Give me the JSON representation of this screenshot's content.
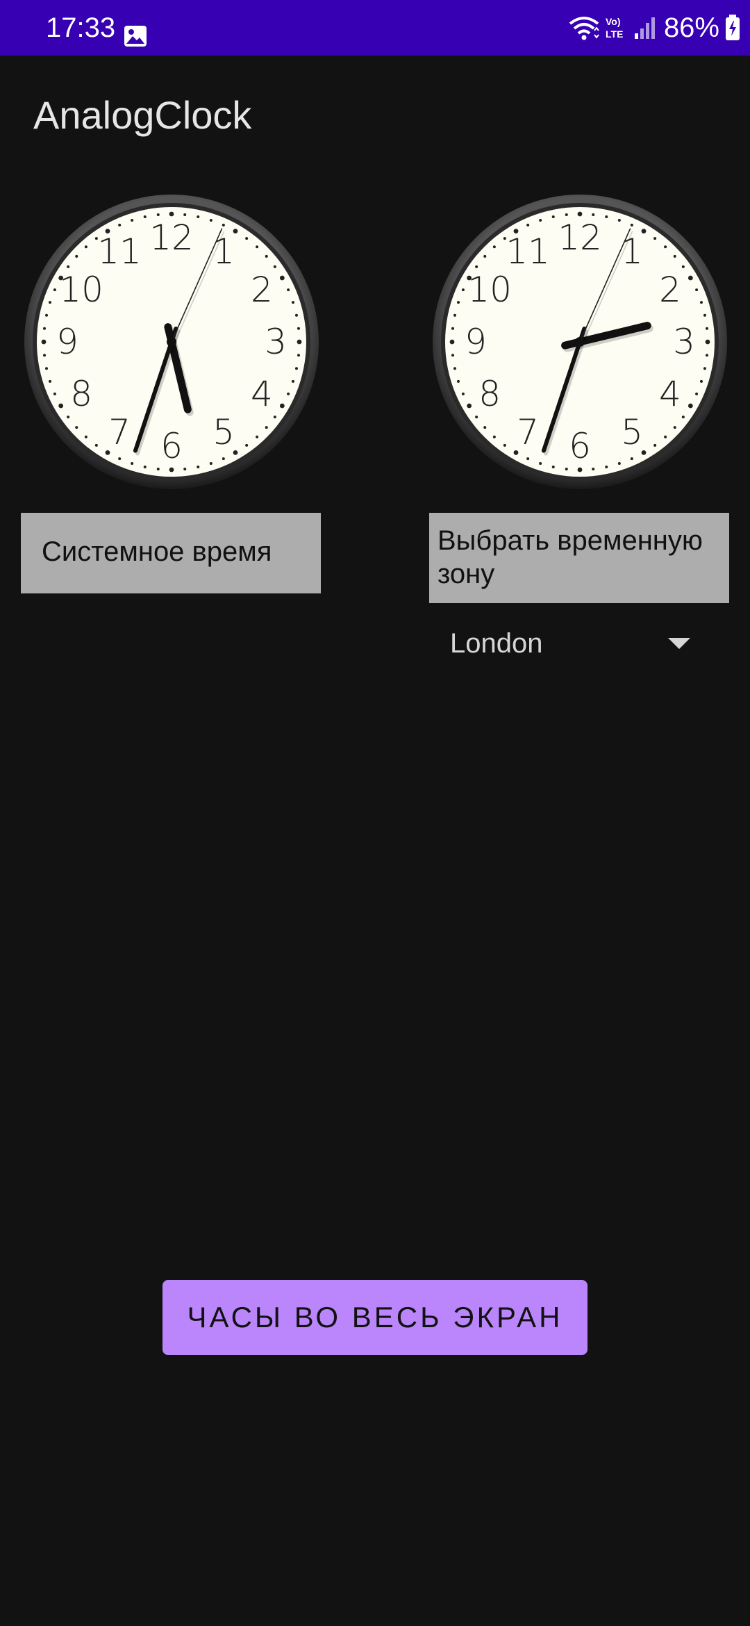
{
  "status_bar": {
    "time": "17:33",
    "battery": "86%",
    "icons": [
      "gallery-icon",
      "wifi-icon",
      "volte-icon",
      "signal-icon",
      "battery-icon"
    ]
  },
  "app": {
    "title": "AnalogClock"
  },
  "clocks": {
    "left": {
      "numerals": [
        "12",
        "1",
        "2",
        "3",
        "4",
        "5",
        "6",
        "7",
        "8",
        "9",
        "10",
        "11"
      ],
      "time": {
        "hour": 17,
        "minute": 33,
        "second": 4
      }
    },
    "right": {
      "numerals": [
        "12",
        "1",
        "2",
        "3",
        "4",
        "5",
        "6",
        "7",
        "8",
        "9",
        "10",
        "11"
      ],
      "time": {
        "hour": 14,
        "minute": 33,
        "second": 4
      }
    }
  },
  "buttons": {
    "system_time": "Системное время",
    "choose_timezone": "Выбрать временную зону",
    "fullscreen": "ЧАСЫ ВО ВЕСЬ ЭКРАН"
  },
  "timezone_spinner": {
    "selected": "London"
  },
  "colors": {
    "status_bar": "#3700b3",
    "background": "#121212",
    "grey_button": "#adadad",
    "accent_button": "#bb86fc",
    "clock_face": "#fdfdf3"
  }
}
